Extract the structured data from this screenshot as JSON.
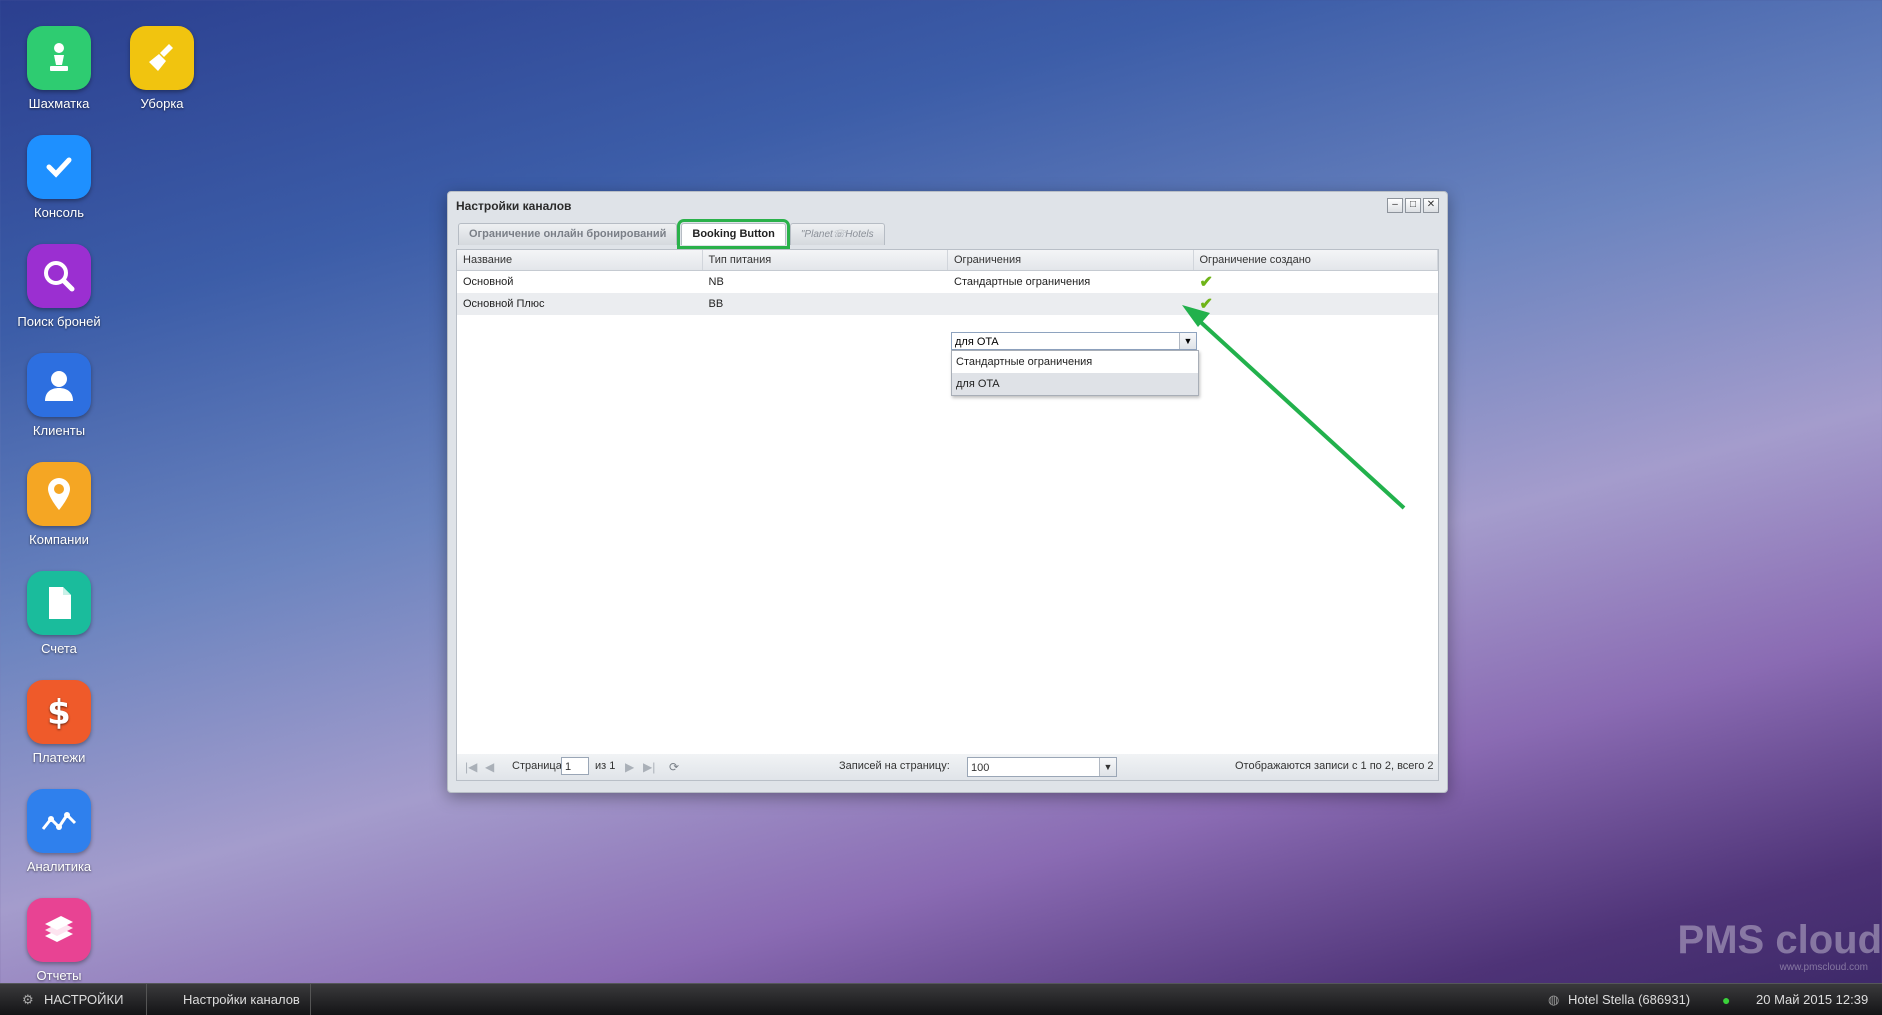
{
  "desktop_icons": [
    {
      "label": "Шахматка",
      "icon": "chess-pawn-icon",
      "color": "#2ecc71"
    },
    {
      "label": "Уборка",
      "icon": "broom-icon",
      "color": "#f1c40f"
    },
    {
      "label": "Консоль",
      "icon": "checkmark-icon",
      "color": "#1e90ff"
    },
    {
      "label": "Поиск броней",
      "icon": "magnifier-icon",
      "color": "#9b2fd1"
    },
    {
      "label": "Клиенты",
      "icon": "person-icon",
      "color": "#2d6fe0"
    },
    {
      "label": "Компании",
      "icon": "map-pin-icon",
      "color": "#f5a623"
    },
    {
      "label": "Счета",
      "icon": "document-icon",
      "color": "#1abc9c"
    },
    {
      "label": "Платежи",
      "icon": "dollar-icon",
      "color": "#ef5a2a"
    },
    {
      "label": "Аналитика",
      "icon": "chart-icon",
      "color": "#2f80ed"
    },
    {
      "label": "Отчеты",
      "icon": "books-icon",
      "color": "#e84393"
    }
  ],
  "window": {
    "title": "Настройки каналов",
    "controls": [
      "–",
      "□",
      "✕"
    ],
    "tabs": [
      "Ограничение онлайн бронирований",
      "Booking Button",
      "\"Planet☏Hotels"
    ],
    "columns": [
      "Название",
      "Тип питания",
      "Ограничения",
      "Ограничение создано"
    ],
    "rows": [
      {
        "name": "Основной",
        "meal": "NB",
        "restriction": "Стандартные ограничения",
        "created": "✔"
      },
      {
        "name": "Основной Плюс",
        "meal": "BB",
        "restriction": "для OTA",
        "created": "✔"
      }
    ],
    "combo_value": "для OTA",
    "dropdown_options": [
      "Стандартные ограничения",
      "для OTA"
    ],
    "pager": {
      "page_label": "Страница",
      "page_value": "1",
      "of_label": "из 1",
      "per_page_label": "Записей на страницу:",
      "per_page_value": "100",
      "status": "Отображаются записи с 1 по 2, всего 2"
    }
  },
  "taskbar": {
    "settings": "НАСТРОЙКИ",
    "open_window": "Настройки каналов",
    "hotel": "Hotel Stella (686931)",
    "datetime": "20 Май 2015 12:39"
  },
  "watermark": {
    "brand": "PMS cloud",
    "url": "www.pmscloud.com"
  }
}
